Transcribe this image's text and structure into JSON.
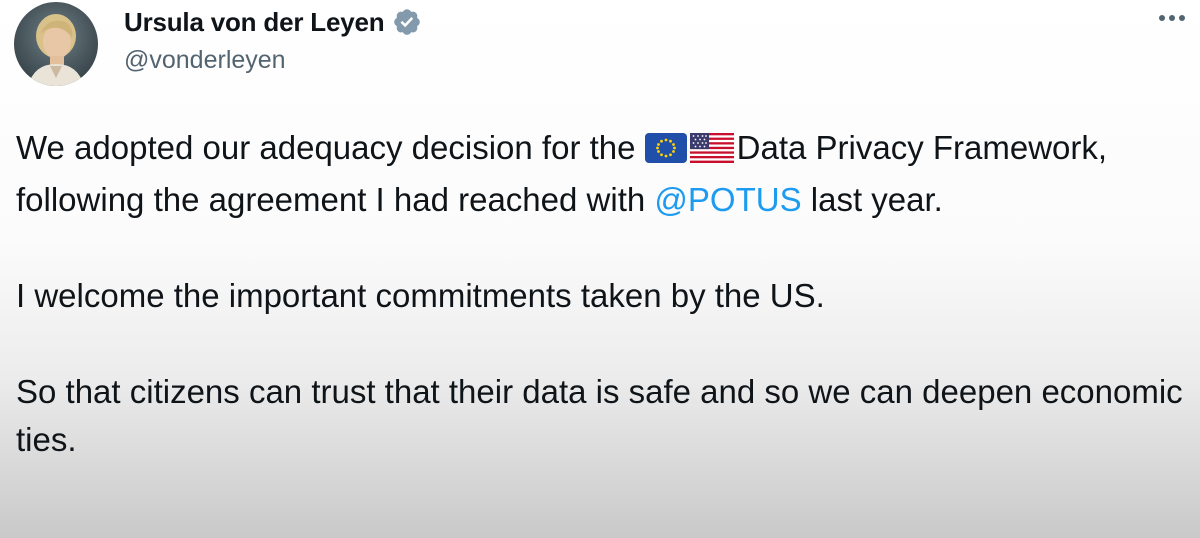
{
  "author": {
    "name": "Ursula von der Leyen",
    "handle": "@vonderleyen",
    "verified": true
  },
  "icons": {
    "verified": "verified-badge-icon",
    "more": "more-horizontal-icon",
    "flag_eu": "eu-flag-icon",
    "flag_us": "us-flag-icon"
  },
  "colors": {
    "mention": "#1d9bf0",
    "verified_badge": "#829aab",
    "text": "#0f1419",
    "handle": "#536471"
  },
  "tweet": {
    "paragraph1": {
      "part1": "We adopted our adequacy decision for the ",
      "part2": "Data Privacy Framework, following the agreement I had reached with ",
      "mention": "@POTUS",
      "part3": " last year."
    },
    "paragraph2": "I welcome the important commitments taken by the US.",
    "paragraph3": "So that citizens can trust that their data is safe and so we can deepen economic ties."
  }
}
